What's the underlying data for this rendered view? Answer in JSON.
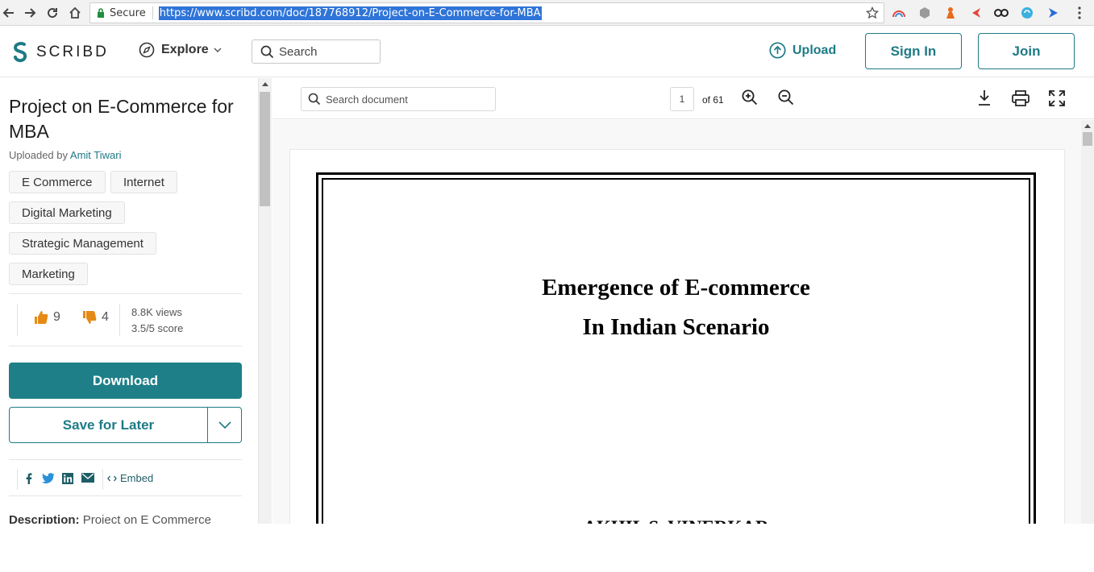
{
  "browser": {
    "secure_label": "Secure",
    "url": "https://www.scribd.com/doc/187768912/Project-on-E-Commerce-for-MBA"
  },
  "header": {
    "logo_text": "SCRIBD",
    "explore_label": "Explore",
    "search_placeholder": "Search",
    "upload_label": "Upload",
    "sign_in_label": "Sign In",
    "join_label": "Join",
    "accent_color": "#1e7b85"
  },
  "sidebar": {
    "title": "Project on E-Commerce for MBA",
    "uploaded_by_label": "Uploaded by",
    "author": "Amit Tiwari",
    "tags": [
      "E Commerce",
      "Internet",
      "Digital Marketing",
      "Strategic Management",
      "Marketing"
    ],
    "upvotes": "9",
    "downvotes": "4",
    "views": "8.8K views",
    "score": "3.5/5 score",
    "download_label": "Download",
    "save_label": "Save for Later",
    "embed_label": "Embed",
    "description_label": "Description:",
    "description_text": "Project on E Commerce"
  },
  "viewer": {
    "search_placeholder": "Search document",
    "current_page": "1",
    "page_total": "of 61",
    "doc_heading_line1": "Emergence of E-commerce",
    "doc_heading_line2": "In Indian Scenario",
    "doc_author": "AKHIL S. VINERKAR"
  }
}
